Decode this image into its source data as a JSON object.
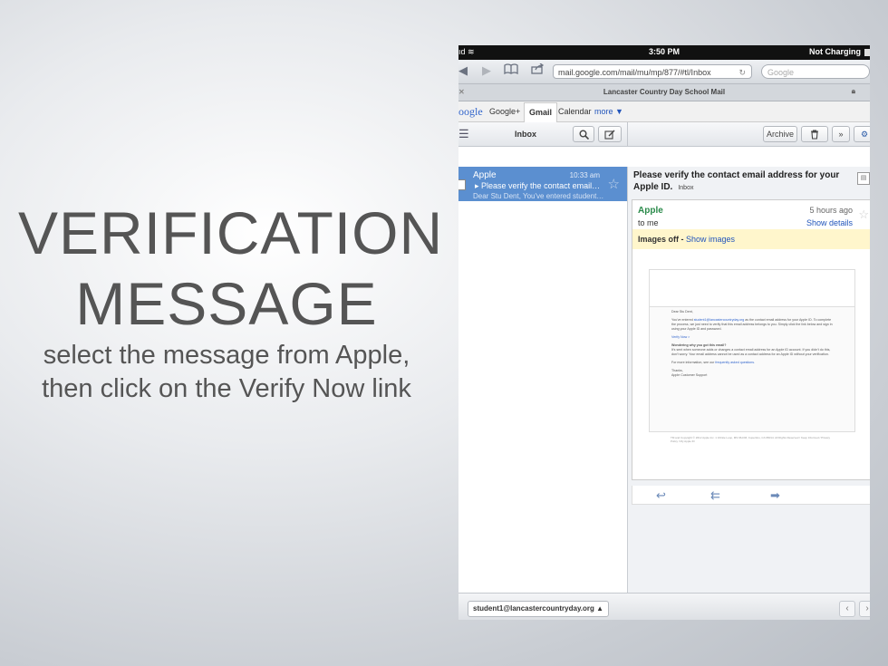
{
  "slide": {
    "title_line1": "VERIFICATION",
    "title_line2": "MESSAGE",
    "subtitle_line1": "select the message from Apple,",
    "subtitle_line2": "then click on the Verify Now link"
  },
  "status_bar": {
    "carrier": "ıd",
    "time": "3:50 PM",
    "battery": "Not Charging"
  },
  "browser": {
    "url": "mail.google.com/mail/mu/mp/877/#tl/Inbox",
    "search_placeholder": "Google",
    "tab_title": "Lancaster Country Day School Mail"
  },
  "google_bar": {
    "logo": "oogle",
    "items": [
      "Google+",
      "Gmail",
      "Calendar",
      "more ▼"
    ]
  },
  "gmail": {
    "inbox_label": "Inbox",
    "archive_label": "Archive",
    "messages": [
      {
        "from": "Apple",
        "time": "10:33 am",
        "subject": "Please verify the contact email address for your Apple ID.",
        "snippet": "Dear Stu Dent, You've entered student1@lancastercountryday.org"
      }
    ],
    "open_message": {
      "subject": "Please verify the contact email address for your Apple ID.",
      "label": "Inbox",
      "sender": "Apple",
      "time_ago": "5 hours ago",
      "recipient": "to me",
      "show_details": "Show details",
      "images_off": "Images off -",
      "show_images": "Show images",
      "body": {
        "greeting": "Dear Stu Dent,",
        "p1_pre": "You've entered",
        "p1_email": "student1@lancastercountryday.org",
        "p1_post": "as the contact email address for your Apple ID. To complete the process, we just need to verify that this email address belongs to you. Simply click the link below and sign in using your Apple ID and password.",
        "verify_link": "Verify Now >",
        "h2": "Wondering why you got this email?",
        "p2": "It's sent when someone adds or changes a contact email address for an Apple ID account. If you didn't do this, don't worry. Your email address cannot be used as a contact address for an Apple ID without your verification.",
        "p3_pre": "For more information, see our",
        "p3_link": "frequently asked questions.",
        "signoff": "Thanks,",
        "team": "Apple Customer Support",
        "footer": "TM and Copyright © 2012 Apple Inc. 1 Infinite Loop, MS 96-DM, Cupertino, CA 95014. All Rights Reserved / Keep Informed / Privacy Policy / My Apple ID"
      }
    },
    "account": "student1@lancastercountryday.org"
  },
  "icons": {
    "wifi": "wifi-icon",
    "back": "back-arrow-icon",
    "forward": "forward-arrow-icon",
    "bookmarks": "book-icon",
    "share": "share-icon",
    "reload": "reload-icon",
    "menu": "menu-icon",
    "search": "search-icon",
    "compose": "compose-icon",
    "trash": "trash-icon",
    "more": "double-chevron-icon",
    "settings": "gear-icon",
    "reply": "reply-icon",
    "reply_all": "reply-all-icon",
    "forward_mail": "forward-icon",
    "star": "star-icon",
    "lock": "lock-icon"
  },
  "colors": {
    "selected_row": "#5b8fd0",
    "sender_green": "#2a8a4a",
    "link_blue": "#2255bb",
    "images_off_bg": "#fff6cc"
  }
}
